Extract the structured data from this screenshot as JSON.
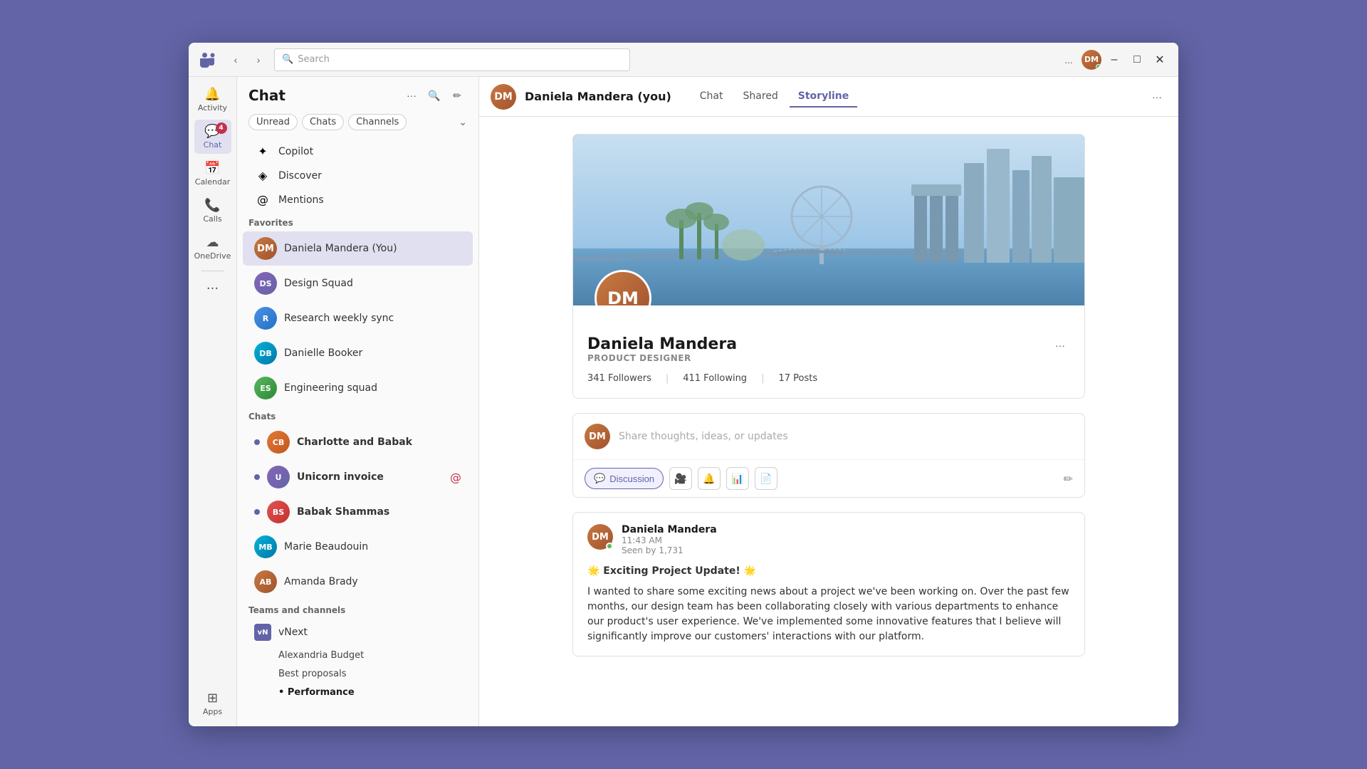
{
  "window": {
    "title": "Microsoft Teams",
    "logo": "T",
    "search_placeholder": "Search"
  },
  "titlebar": {
    "search_placeholder": "Search",
    "more_label": "...",
    "minimize_label": "–",
    "maximize_label": "□",
    "close_label": "✕",
    "user_initials": "DM"
  },
  "rail": {
    "items": [
      {
        "id": "activity",
        "icon": "🔔",
        "label": "Activity"
      },
      {
        "id": "chat",
        "icon": "💬",
        "label": "Chat",
        "badge": "4",
        "active": true
      },
      {
        "id": "calendar",
        "icon": "📅",
        "label": "Calendar"
      },
      {
        "id": "calls",
        "icon": "📞",
        "label": "Calls"
      },
      {
        "id": "onedrive",
        "icon": "☁",
        "label": "OneDrive"
      },
      {
        "id": "more",
        "icon": "···",
        "label": ""
      },
      {
        "id": "apps",
        "icon": "⊞",
        "label": "Apps"
      }
    ]
  },
  "sidebar": {
    "title": "Chat",
    "more_label": "···",
    "search_label": "🔍",
    "compose_label": "✏",
    "filters": [
      {
        "id": "unread",
        "label": "Unread",
        "active": false
      },
      {
        "id": "chats",
        "label": "Chats",
        "active": false
      },
      {
        "id": "channels",
        "label": "Channels",
        "active": false
      }
    ],
    "nav_items": [
      {
        "id": "copilot",
        "icon": "✦",
        "label": "Copilot"
      },
      {
        "id": "discover",
        "icon": "◈",
        "label": "Discover"
      },
      {
        "id": "mentions",
        "icon": "◎",
        "label": "Mentions"
      }
    ],
    "favorites_label": "Favorites",
    "favorites": [
      {
        "id": "daniela",
        "name": "Daniela Mandera (You)",
        "color": "av-brown",
        "initials": "DM",
        "active": true
      },
      {
        "id": "design-squad",
        "name": "Design Squad",
        "color": "av-purple",
        "initials": "DS"
      },
      {
        "id": "research-sync",
        "name": "Research weekly sync",
        "color": "av-blue",
        "initials": "R"
      },
      {
        "id": "danielle",
        "name": "Danielle Booker",
        "color": "av-teal",
        "initials": "DB"
      },
      {
        "id": "eng-squad",
        "name": "Engineering squad",
        "color": "av-green",
        "initials": "ES"
      }
    ],
    "chats_label": "Chats",
    "chats": [
      {
        "id": "charlotte",
        "name": "Charlotte and Babak",
        "color": "av-orange",
        "initials": "CB",
        "unread": true,
        "bold": true
      },
      {
        "id": "unicorn",
        "name": "Unicorn invoice",
        "color": "av-purple",
        "initials": "U",
        "unread": true,
        "bold": true,
        "mention": true
      },
      {
        "id": "babak",
        "name": "Babak Shammas",
        "color": "av-red",
        "initials": "BS",
        "unread": true,
        "bold": true
      },
      {
        "id": "marie",
        "name": "Marie Beaudouin",
        "color": "av-teal",
        "initials": "MB"
      },
      {
        "id": "amanda",
        "name": "Amanda Brady",
        "color": "av-brown",
        "initials": "AB"
      }
    ],
    "teams_label": "Teams and channels",
    "teams": [
      {
        "id": "vnext",
        "name": "vNext",
        "icon": "vN",
        "channels": [
          {
            "name": "Alexandria Budget"
          },
          {
            "name": "Best proposals"
          },
          {
            "name": "Performance",
            "bold": true
          }
        ]
      }
    ]
  },
  "content": {
    "person_name": "Daniela Mandera (you)",
    "person_initials": "DM",
    "tabs": [
      {
        "id": "chat",
        "label": "Chat"
      },
      {
        "id": "shared",
        "label": "Shared"
      },
      {
        "id": "storyline",
        "label": "Storyline",
        "active": true
      }
    ],
    "more_label": "···",
    "profile": {
      "name": "Daniela Mandera",
      "title": "PRODUCT DESIGNER",
      "followers": "341 Followers",
      "following": "411 Following",
      "posts": "17 Posts",
      "initials": "DM"
    },
    "compose": {
      "placeholder": "Share thoughts, ideas, or updates",
      "buttons": [
        {
          "id": "discussion",
          "label": "Discussion",
          "active": true,
          "icon": "💬"
        },
        {
          "id": "video",
          "label": "",
          "icon": "🎥"
        },
        {
          "id": "bell",
          "label": "",
          "icon": "🔔"
        },
        {
          "id": "chart",
          "label": "",
          "icon": "📊"
        },
        {
          "id": "doc",
          "label": "",
          "icon": "📄"
        }
      ]
    },
    "post": {
      "author": "Daniela Mandera",
      "author_initials": "DM",
      "time": "11:43 AM",
      "seen": "Seen by 1,731",
      "title": "🌟 Exciting Project Update! 🌟",
      "body": "I wanted to share some exciting news about a project we've been working on. Over the past few months, our design team has been collaborating closely with various departments to enhance our product's user experience. We've implemented some innovative features that I believe will significantly improve our customers' interactions with our platform."
    }
  }
}
